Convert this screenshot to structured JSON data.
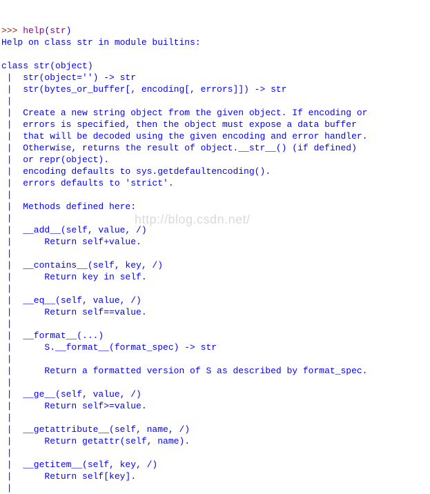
{
  "line1": {
    "prompt": ">>> ",
    "fn": "help",
    "paren_open": "(",
    "arg": "str",
    "paren_close": ")"
  },
  "l2": "Help on class str in module builtins:",
  "l3": "",
  "l4": "class str(object)",
  "l5": " |  str(object='') -> str",
  "l6": " |  str(bytes_or_buffer[, encoding[, errors]]) -> str",
  "l7": " |  ",
  "l8": " |  Create a new string object from the given object. If encoding or",
  "l9": " |  errors is specified, then the object must expose a data buffer",
  "l10": " |  that will be decoded using the given encoding and error handler.",
  "l11": " |  Otherwise, returns the result of object.__str__() (if defined)",
  "l12": " |  or repr(object).",
  "l13": " |  encoding defaults to sys.getdefaultencoding().",
  "l14": " |  errors defaults to 'strict'.",
  "l15": " |  ",
  "l16": " |  Methods defined here:",
  "l17": " |  ",
  "l18": " |  __add__(self, value, /)",
  "l19": " |      Return self+value.",
  "l20": " |  ",
  "l21": " |  __contains__(self, key, /)",
  "l22": " |      Return key in self.",
  "l23": " |  ",
  "l24": " |  __eq__(self, value, /)",
  "l25": " |      Return self==value.",
  "l26": " |  ",
  "l27": " |  __format__(...)",
  "l28": " |      S.__format__(format_spec) -> str",
  "l29": " |      ",
  "l30": " |      Return a formatted version of S as described by format_spec.",
  "l31": " |  ",
  "l32": " |  __ge__(self, value, /)",
  "l33": " |      Return self>=value.",
  "l34": " |  ",
  "l35": " |  __getattribute__(self, name, /)",
  "l36": " |      Return getattr(self, name).",
  "l37": " |  ",
  "l38": " |  __getitem__(self, key, /)",
  "l39": " |      Return self[key].",
  "l40": " |  ",
  "watermark": "http://blog.csdn.net/"
}
